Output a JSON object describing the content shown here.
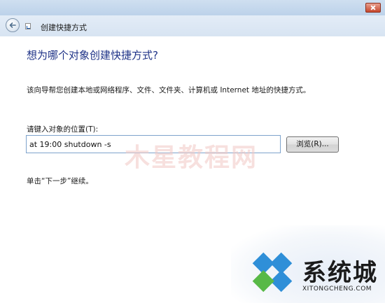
{
  "window": {
    "title": "创建快捷方式"
  },
  "wizard": {
    "heading": "想为哪个对象创建快捷方式?",
    "description": "该向导帮您创建本地或网络程序、文件、文件夹、计算机或 Internet 地址的快捷方式。",
    "location_label": "请键入对象的位置(T):",
    "location_value": "at 19:00 shutdown -s",
    "browse_label": "浏览(R)...",
    "hint": "单击“下一步”继续。"
  },
  "watermark": {
    "text": "木星教程网"
  },
  "branding": {
    "name": "系统城",
    "domain": "XITONGCHENG.COM",
    "logo_colors": [
      "#2f8fd8",
      "#58b947",
      "#2f8fd8",
      "#2f8fd8"
    ]
  },
  "icons": {
    "back": "back-arrow-icon",
    "wizard": "shortcut-wizard-icon",
    "close": "close-icon"
  }
}
